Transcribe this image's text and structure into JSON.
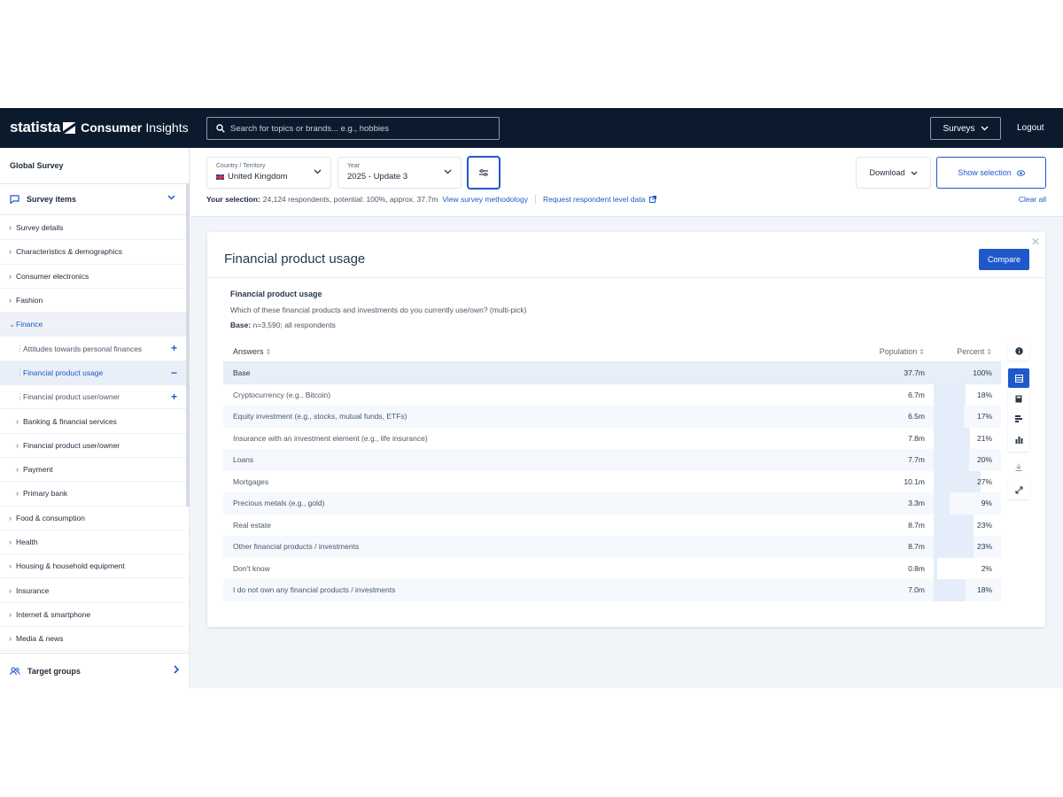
{
  "brand": {
    "name": "statista",
    "product": "Consumer",
    "product_suffix": "Insights"
  },
  "search": {
    "placeholder": "Search for topics or brands... e.g., hobbies"
  },
  "header": {
    "surveys_label": "Surveys",
    "logout_label": "Logout"
  },
  "sidebar": {
    "survey_name": "Global Survey",
    "section_label": "Survey items",
    "items": [
      {
        "label": "Survey details",
        "level": 1
      },
      {
        "label": "Characteristics & demographics",
        "level": 1
      },
      {
        "label": "Consumer electronics",
        "level": 1
      },
      {
        "label": "Fashion",
        "level": 1
      },
      {
        "label": "Finance",
        "level": 1,
        "expanded": true
      },
      {
        "label": "Attitudes towards personal finances",
        "level": 3,
        "action": "+"
      },
      {
        "label": "Financial product usage",
        "level": 3,
        "action": "−",
        "active": true
      },
      {
        "label": "Financial product user/owner",
        "level": 3,
        "action": "+"
      },
      {
        "label": "Banking & financial services",
        "level": 2
      },
      {
        "label": "Financial product user/owner",
        "level": 2
      },
      {
        "label": "Payment",
        "level": 2
      },
      {
        "label": "Primary bank",
        "level": 2
      },
      {
        "label": "Food & consumption",
        "level": 1
      },
      {
        "label": "Health",
        "level": 1
      },
      {
        "label": "Housing & household equipment",
        "level": 1
      },
      {
        "label": "Insurance",
        "level": 1
      },
      {
        "label": "Internet & smartphone",
        "level": 1
      },
      {
        "label": "Media & news",
        "level": 1
      }
    ],
    "target_groups_label": "Target groups"
  },
  "selection": {
    "country_key": "Country / Territory",
    "country_value": "United Kingdom",
    "year_key": "Year",
    "year_value": "2025 - Update 3",
    "download_label": "Download",
    "show_selection_label": "Show selection",
    "info_prefix": "Your selection:",
    "info_text": "24,124 respondents, potential: 100%, approx. 37.7m",
    "methodology_link": "View survey methodology",
    "respondent_link": "Request respondent level data",
    "clear_all_label": "Clear all"
  },
  "card": {
    "title": "Financial product usage",
    "compare_label": "Compare",
    "question_title": "Financial product usage",
    "question_text": "Which of these financial products and investments do you currently use/own? (multi-pick)",
    "base_label": "Base:",
    "base_text": "n=3,590; all respondents",
    "columns": {
      "answers": "Answers",
      "population": "Population",
      "percent": "Percent"
    },
    "rows": [
      {
        "answer": "Base",
        "population": "37.7m",
        "percent": "100%",
        "pct_value": 100
      },
      {
        "answer": "Cryptocurrency (e.g., Bitcoin)",
        "population": "6.7m",
        "percent": "18%",
        "pct_value": 18
      },
      {
        "answer": "Equity investment (e.g., stocks, mutual funds, ETFs)",
        "population": "6.5m",
        "percent": "17%",
        "pct_value": 17
      },
      {
        "answer": "Insurance with an investment element (e.g., life insurance)",
        "population": "7.8m",
        "percent": "21%",
        "pct_value": 21
      },
      {
        "answer": "Loans",
        "population": "7.7m",
        "percent": "20%",
        "pct_value": 20
      },
      {
        "answer": "Mortgages",
        "population": "10.1m",
        "percent": "27%",
        "pct_value": 27
      },
      {
        "answer": "Precious metals (e.g., gold)",
        "population": "3.3m",
        "percent": "9%",
        "pct_value": 9
      },
      {
        "answer": "Real estate",
        "population": "8.7m",
        "percent": "23%",
        "pct_value": 23
      },
      {
        "answer": "Other financial products / investments",
        "population": "8.7m",
        "percent": "23%",
        "pct_value": 23
      },
      {
        "answer": "Don't know",
        "population": "0.8m",
        "percent": "2%",
        "pct_value": 2
      },
      {
        "answer": "I do not own any financial products / investments",
        "population": "7.0m",
        "percent": "18%",
        "pct_value": 18
      }
    ]
  },
  "tools": [
    "info-icon",
    "table-icon",
    "calculator-icon",
    "bar-chart-horizontal-icon",
    "bar-chart-vertical-icon",
    "download-icon",
    "expand-icon"
  ],
  "colors": {
    "accent": "#1f58c9",
    "topbar": "#0b1a2d",
    "bar": "#e4edf9"
  }
}
